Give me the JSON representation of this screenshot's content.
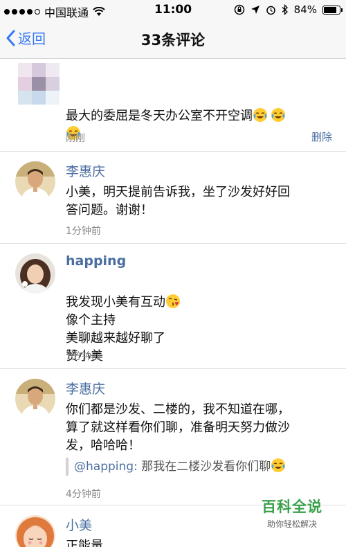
{
  "status_bar": {
    "carrier": "中国联通",
    "time": "11:00",
    "battery": "84%",
    "battery_level": 0.84
  },
  "nav": {
    "back_label": "返回",
    "title": "33条评论"
  },
  "comments": [
    {
      "author": "",
      "text": "最大的委屈是冬天办公室不开空调",
      "time": "刚刚",
      "delete_label": "删除"
    },
    {
      "author": "李惠庆",
      "text": "小美，明天提前告诉我，坐了沙发好好回\n答问题。谢谢！",
      "time": "1分钟前"
    },
    {
      "author": "happing",
      "text_line1": "我发现小美有互动",
      "text_rest": "像个主持\n美聊越来越好聊了\n赞小美",
      "time": "1分钟前"
    },
    {
      "author": "李惠庆",
      "text": "你们都是沙发、二楼的，我不知道在哪，\n算了就这样看你们聊，准备明天努力做沙\n发，哈哈哈！",
      "quote_user": "@happing:",
      "quote_text": " 那我在二楼沙发看你们聊",
      "time": "4分钟前"
    },
    {
      "author": "小美",
      "text": "正能量"
    }
  ],
  "watermark": {
    "title": "百科全说",
    "subtitle": "助你轻松解决"
  }
}
